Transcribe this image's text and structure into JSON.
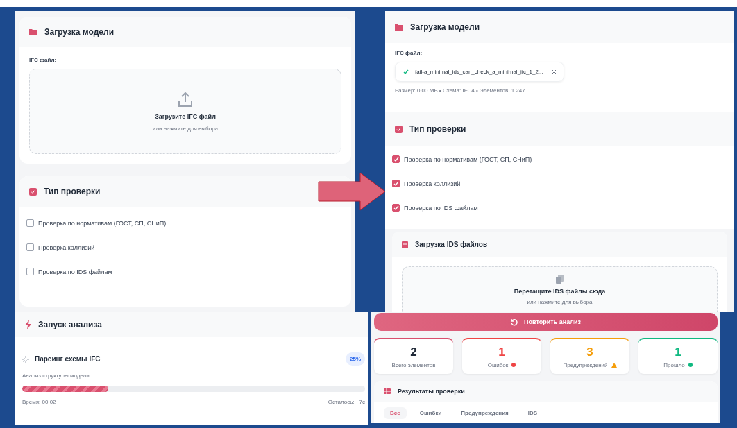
{
  "before": {
    "model_card": {
      "title": "Загрузка модели",
      "file_label": "IFC файл:",
      "dropzone": {
        "title": "Загрузите IFC файл",
        "hint": "или нажмите для выбора"
      }
    },
    "check_card": {
      "title": "Тип проверки",
      "options": [
        {
          "label": "Проверка по нормативам (ГОСТ, СП, СНиП)",
          "checked": false
        },
        {
          "label": "Проверка коллизий",
          "checked": false
        },
        {
          "label": "Проверка по IDS файлам",
          "checked": false
        }
      ]
    },
    "analysis": {
      "title": "Запуск анализа",
      "step": {
        "title": "Парсинг схемы IFC",
        "percent": "25%",
        "description": "Анализ структуры модели...",
        "level": 0.25,
        "time": "Время: 00:02",
        "remaining": "Осталось: ~7с"
      }
    }
  },
  "after": {
    "model_card": {
      "title": "Загрузка модели",
      "file_label": "IFC файл:",
      "file": {
        "name": "fail-a_minimal_ids_can_check_a_minimal_ifc_1_2...",
        "meta": "Размер: 0.00 МБ • Схема: IFC4 • Элементов: 1 247"
      }
    },
    "check_card": {
      "title": "Тип проверки",
      "options": [
        {
          "label": "Проверка по нормативам (ГОСТ, СП, СНиП)",
          "checked": true
        },
        {
          "label": "Проверка коллизий",
          "checked": true
        },
        {
          "label": "Проверка по IDS файлам",
          "checked": true
        }
      ]
    },
    "ids_card": {
      "title": "Загрузка IDS файлов",
      "dropzone": {
        "title": "Перетащите IDS файлы сюда",
        "hint": "или нажмите для выбора"
      }
    },
    "retry_button": "Повторить анализ",
    "stats": [
      {
        "kind": "total",
        "value": "2",
        "label": "Всего элементов"
      },
      {
        "kind": "error",
        "value": "1",
        "label": "Ошибок"
      },
      {
        "kind": "warning",
        "value": "3",
        "label": "Предупреждений"
      },
      {
        "kind": "pass",
        "value": "1",
        "label": "Прошло"
      }
    ],
    "results": {
      "title": "Результаты проверки",
      "tabs": [
        {
          "label": "Все",
          "selected": true
        },
        {
          "label": "Ошибки",
          "selected": false
        },
        {
          "label": "Предупреждения",
          "selected": false
        },
        {
          "label": "IDS",
          "selected": false
        }
      ]
    }
  }
}
